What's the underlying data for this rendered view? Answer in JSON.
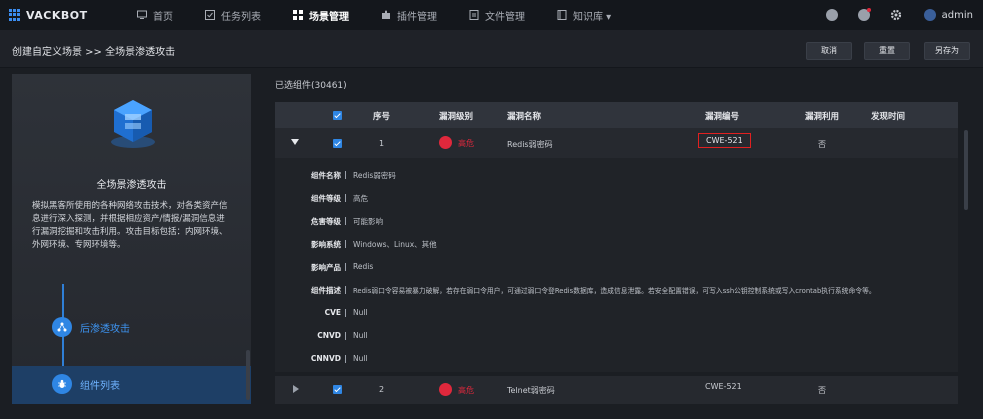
{
  "app": {
    "name": "VACKBOT"
  },
  "nav": {
    "items": [
      {
        "label": "首页"
      },
      {
        "label": "任务列表"
      },
      {
        "label": "场景管理"
      },
      {
        "label": "插件管理"
      },
      {
        "label": "文件管理"
      },
      {
        "label": "知识库 ▾"
      }
    ],
    "active_index": 2,
    "user": "admin"
  },
  "header": {
    "breadcrumb": "创建自定义场景 >> 全场景渗透攻击",
    "buttons": {
      "cancel": "取消",
      "reset": "重置",
      "save_as": "另存为"
    }
  },
  "scene": {
    "title": "全场景渗透攻击",
    "description": "模拟黑客所使用的各种网络攻击技术，对各类资产信息进行深入探测，并根据相应资产/情报/漏洞信息进行漏洞挖掘和攻击利用。攻击目标包括：内网环境、外网环境、专网环境等。",
    "steps": [
      {
        "label": "后渗透攻击"
      },
      {
        "label": "组件列表"
      }
    ]
  },
  "table": {
    "title": "已选组件(30461)",
    "columns": [
      "序号",
      "漏洞级别",
      "漏洞名称",
      "漏洞编号",
      "漏洞利用",
      "发现时间"
    ],
    "rows": [
      {
        "index": "1",
        "level": "高危",
        "name": "Redis弱密码",
        "cve": "CWE-521",
        "exploit": "否",
        "time": ""
      },
      {
        "index": "2",
        "level": "高危",
        "name": "Telnet弱密码",
        "cve": "CWE-521",
        "exploit": "否",
        "time": ""
      }
    ],
    "detail": [
      {
        "label": "组件名称",
        "value": "Redis弱密码"
      },
      {
        "label": "组件等级",
        "value": "高危"
      },
      {
        "label": "危害等级",
        "value": "可能影响"
      },
      {
        "label": "影响系统",
        "value": "Windows、Linux、其他"
      },
      {
        "label": "影响产品",
        "value": "Redis"
      },
      {
        "label": "组件描述",
        "value": "Redis弱口令容易被暴力破解，若存在弱口令用户，可通过弱口令登Redis数据库，造成信息泄露。若安全配置错误，可写入ssh公钥控制系统或写入crontab执行系统命令等。"
      },
      {
        "label": "CVE",
        "value": "Null"
      },
      {
        "label": "CNVD",
        "value": "Null"
      },
      {
        "label": "CNNVD",
        "value": "Null"
      }
    ]
  },
  "colors": {
    "accent": "#2f86e4",
    "danger": "#e0283c",
    "highlight_border": "#e12020"
  }
}
